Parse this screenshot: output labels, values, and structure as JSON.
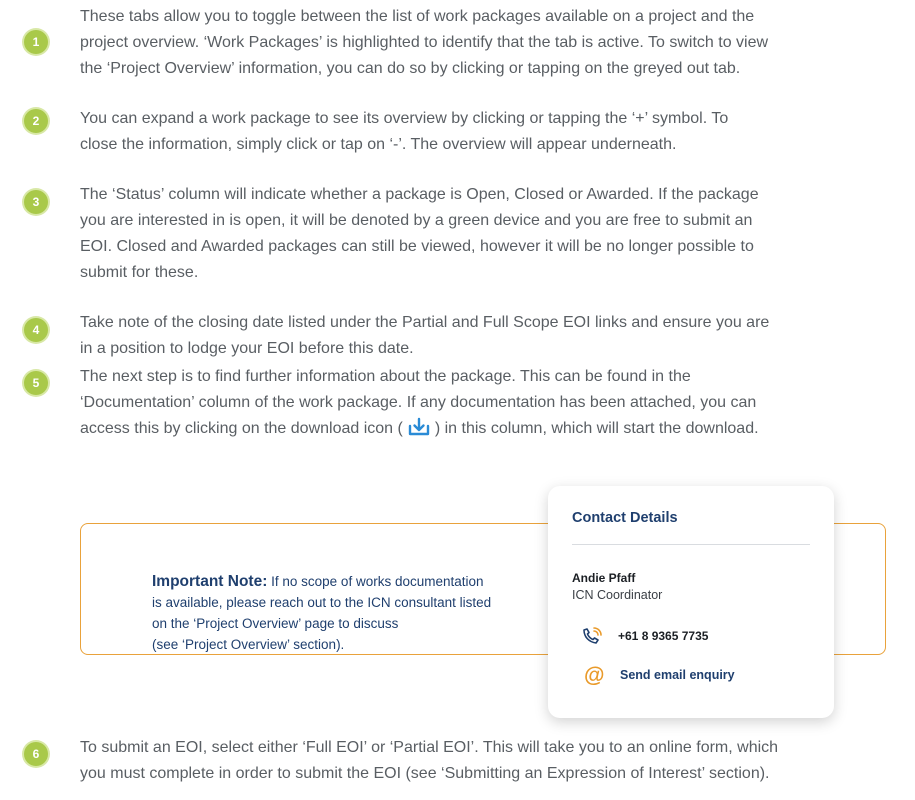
{
  "steps": [
    {
      "number": "1",
      "text": "These tabs allow you to toggle between the list of work packages available on a project and the\nproject overview. ‘Work Packages’ is highlighted to identify that the tab is active. To switch to view\nthe ‘Project Overview’ information, you can do so by clicking or tapping on the greyed out tab."
    },
    {
      "number": "2",
      "text": "You can expand a work package to see its overview by clicking or tapping the ‘+’ symbol. To\nclose the information, simply click or tap on ‘-’. The overview will appear underneath."
    },
    {
      "number": "3",
      "text": "The ‘Status’ column will indicate whether a package is Open, Closed or Awarded. If the package\nyou are interested in is open, it will be denoted by a green device and you are free to submit an\nEOI. Closed and Awarded packages can still be viewed, however it will be no longer possible to\nsubmit for these."
    },
    {
      "number": "4",
      "text": "Take note of the closing date listed under the Partial and Full Scope EOI links and ensure you are\nin a position to lodge your EOI before this date."
    },
    {
      "number": "5",
      "text_a": "The next step is to find further information about the package.  This can be found in the\n‘Documentation’ column of the work package. If any documentation has been attached, you can\naccess this by clicking on the download icon (",
      "text_b": ") in this column, which will start the download."
    },
    {
      "number": "6",
      "text": "To submit an EOI, select either ‘Full EOI’ or ‘Partial EOI’. This will take you to an online form, which\nyou must complete in order to submit the EOI (see ‘Submitting an Expression of Interest’ section)."
    }
  ],
  "note": {
    "lead": "Important Note:",
    "body": " If no scope of works documentation\nis available, please reach out to the ICN consultant listed\non the ‘Project Overview’ page to discuss\n(see ‘Project Overview’ section)."
  },
  "contact": {
    "title": "Contact Details",
    "name": "Andie Pfaff",
    "role": "ICN Coordinator",
    "phone": "+61 8 9365 7735",
    "phone_icon": "phone-icon",
    "email_icon": "at-icon",
    "email_label": "Send email enquiry"
  },
  "colors": {
    "badge": "#a9c94a",
    "note_border": "#e9a23b",
    "navy": "#1f3f6e",
    "accent_orange": "#e99a2a"
  }
}
